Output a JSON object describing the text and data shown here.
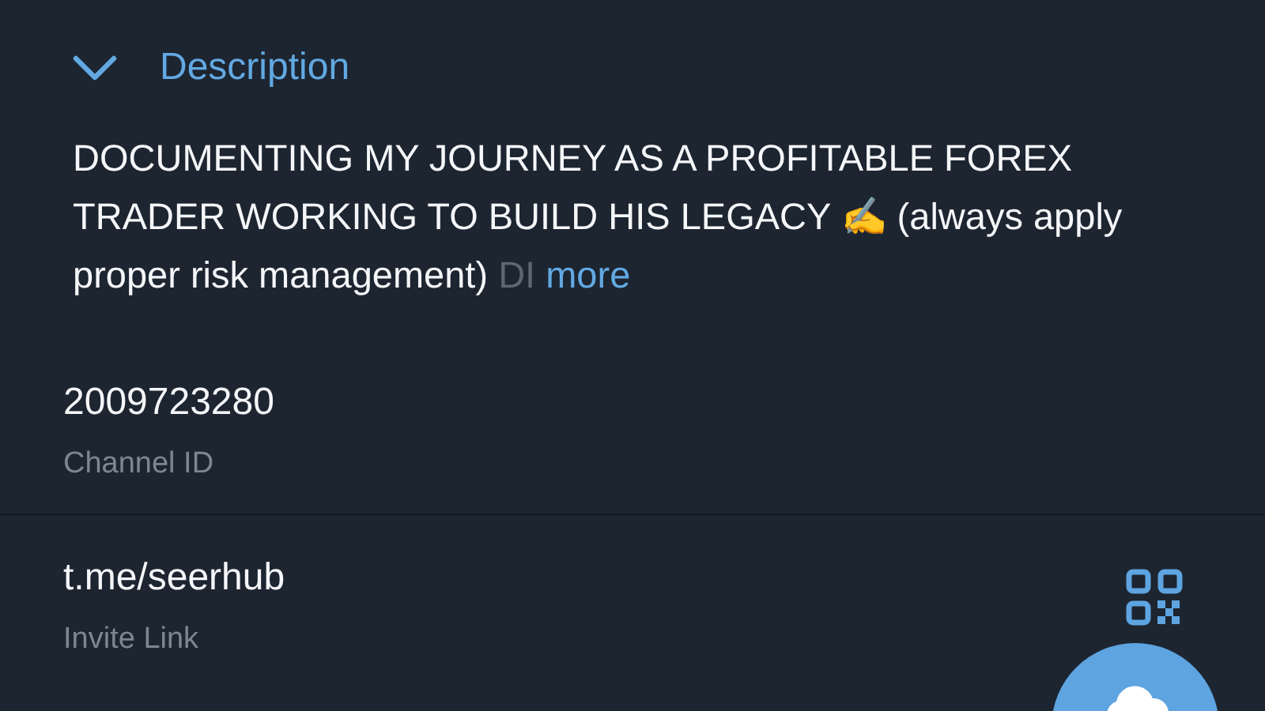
{
  "section": {
    "title": "Description",
    "expanded": true
  },
  "description": {
    "text": "DOCUMENTING MY JOURNEY AS A PROFITABLE FOREX TRADER WORKING TO BUILD HIS LEGACY ✍️ (always apply proper risk management)",
    "faded_tail": "DI",
    "more_link": "more"
  },
  "info_rows": [
    {
      "value": "2009723280",
      "label": "Channel ID",
      "kind": "plain"
    },
    {
      "value": "t.me/seerhub",
      "label": "Invite Link",
      "kind": "link"
    }
  ]
}
